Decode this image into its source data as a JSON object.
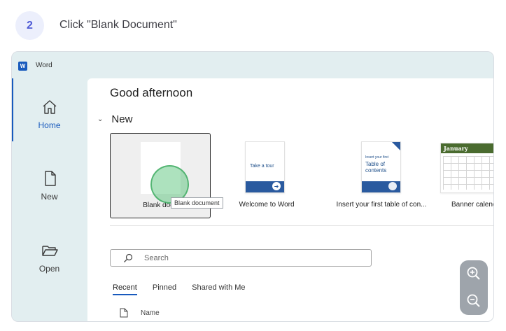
{
  "step": {
    "number": "2",
    "instruction": "Click \"Blank Document\""
  },
  "app": {
    "title": "Word",
    "icon": "word-app-icon"
  },
  "leftnav": {
    "items": [
      {
        "label": "Home",
        "icon": "home-icon",
        "active": true
      },
      {
        "label": "New",
        "icon": "new-document-icon",
        "active": false
      },
      {
        "label": "Open",
        "icon": "folder-open-icon",
        "active": false
      }
    ]
  },
  "main": {
    "greeting": "Good afternoon",
    "new_section": "New",
    "templates": [
      {
        "label": "Blank document",
        "display_label": "Blank docu"
      },
      {
        "label": "Welcome to Word",
        "thumb_text": "Take a tour"
      },
      {
        "label": "Insert your first table of con...",
        "thumb_small": "Insert your first",
        "thumb_title": "Table of contents"
      },
      {
        "label": "Banner calenda",
        "thumb_title": "January"
      }
    ],
    "tooltip": "Blank document",
    "search": {
      "placeholder": "Search"
    },
    "tabs": [
      {
        "label": "Recent",
        "active": true
      },
      {
        "label": "Pinned",
        "active": false
      },
      {
        "label": "Shared with Me",
        "active": false
      }
    ],
    "file_list": {
      "name_header": "Name"
    }
  },
  "zoom": {
    "zoom_in_icon": "zoom-in-icon",
    "zoom_out_icon": "zoom-out-icon"
  },
  "colors": {
    "accent": "#185abd",
    "nav_bg": "#e2eef0",
    "step_accent": "#4f5bd5",
    "click_marker": "#4abe6e"
  }
}
